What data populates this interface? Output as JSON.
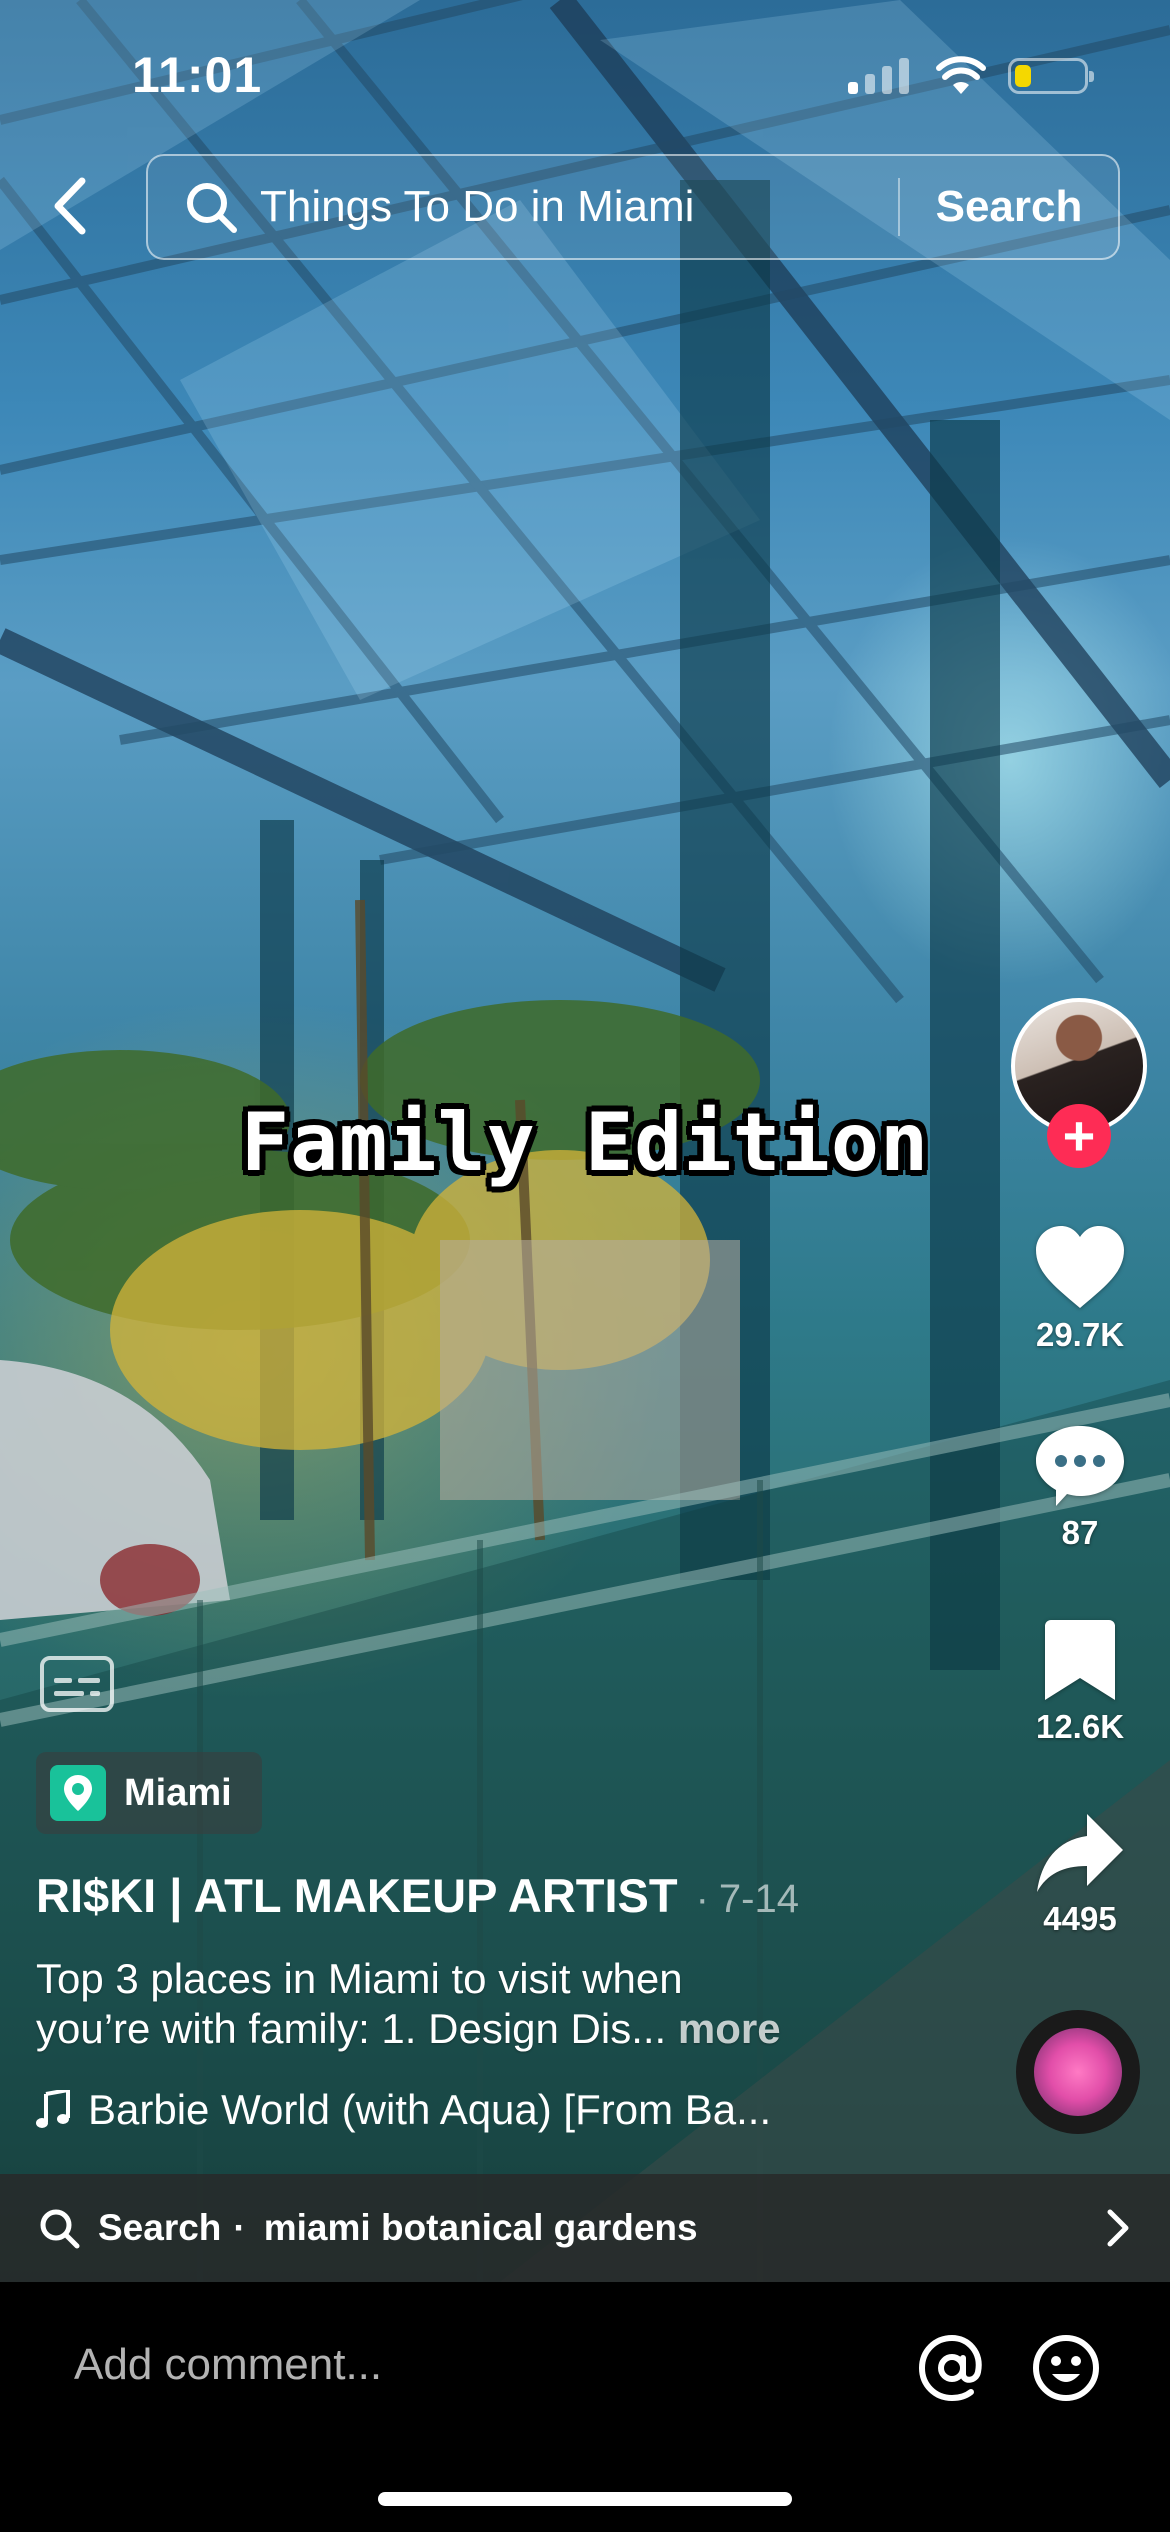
{
  "status_bar": {
    "time": "11:01",
    "battery_color": "#f5d800"
  },
  "top_bar": {
    "back_icon": "chevron-left-icon",
    "search_query": "Things To Do in Miami",
    "search_button": "Search"
  },
  "video": {
    "overlay_caption": "Family Edition"
  },
  "actions": {
    "follow_symbol": "+",
    "likes": "29.7K",
    "comments": "87",
    "saves": "12.6K",
    "shares": "4495",
    "accent_color": "#fe2c55"
  },
  "post": {
    "location": "Miami",
    "author": "RI$KI | ATL MAKEUP ARTIST",
    "date_separator": "·",
    "date": "7-14",
    "description_line1": "Top 3 places in Miami to visit when",
    "description_line2": "you’re with family:  1. Design Dis...",
    "more_label": "more",
    "music": "Barbie World (with Aqua) [From Ba..."
  },
  "search_suggestion": {
    "lead": "Search",
    "separator": "·",
    "term": "miami botanical gardens"
  },
  "comment_bar": {
    "placeholder": "Add comment..."
  }
}
